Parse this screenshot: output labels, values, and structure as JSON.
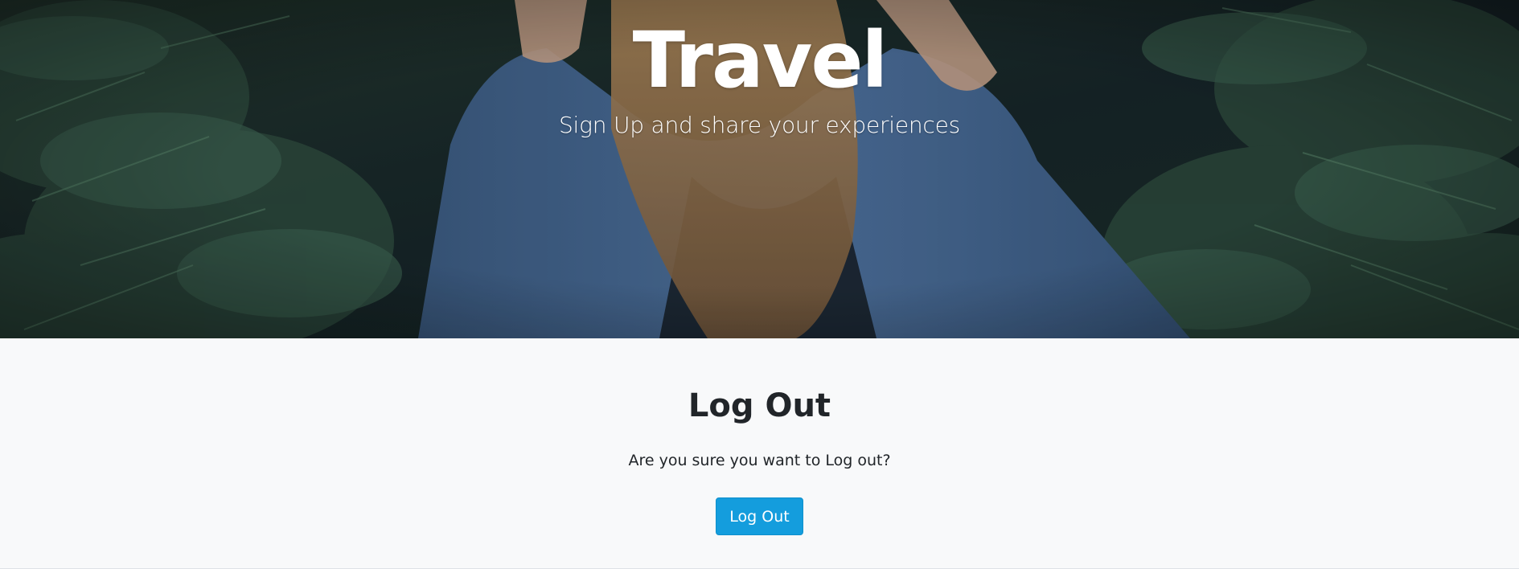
{
  "hero": {
    "title": "Travel",
    "subtitle": "Sign Up and share your experiences"
  },
  "logout": {
    "heading": "Log Out",
    "message": "Are you sure you want to Log out?",
    "button_label": "Log Out"
  },
  "colors": {
    "button": "#149ddd",
    "page_background": "#f8f9fa",
    "text": "#212529"
  }
}
